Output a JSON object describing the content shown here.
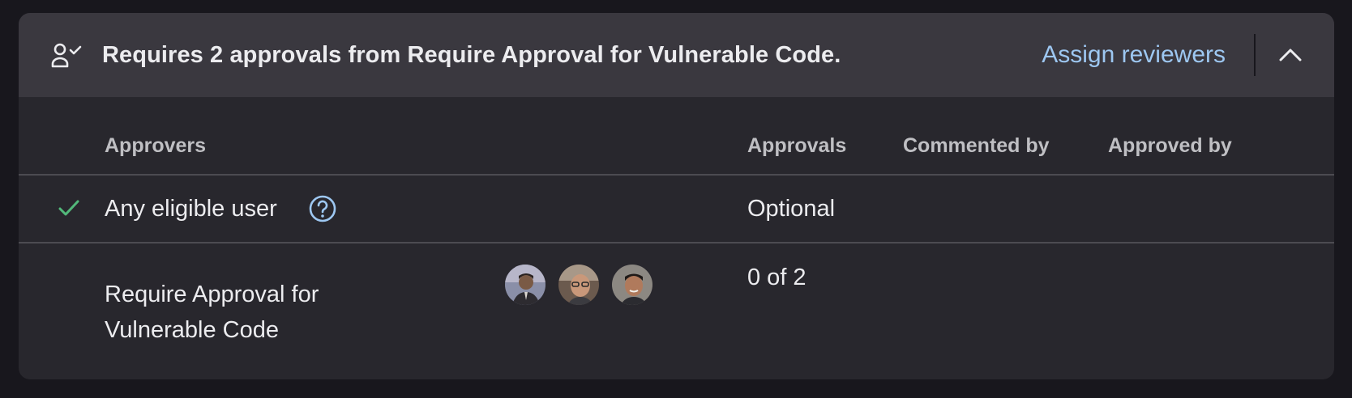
{
  "header": {
    "title": "Requires 2 approvals from Require Approval for Vulnerable Code.",
    "assign_label": "Assign reviewers",
    "approval_icon": "user-check-icon",
    "collapse_icon": "chevron-up-icon"
  },
  "table": {
    "columns": [
      "Approvers",
      "Approvals",
      "Commented by",
      "Approved by"
    ],
    "rows": [
      {
        "status_icon": "check-icon",
        "approver": "Any eligible user",
        "help_icon": "question-circle-icon",
        "approvals": "Optional"
      },
      {
        "approver": "Require Approval for Vulnerable Code",
        "approvals": "0 of 2",
        "approver_avatars": 3
      }
    ]
  },
  "colors": {
    "background": "#18171d",
    "panel": "#28272d",
    "header": "#3a383f",
    "link": "#9dc7f1",
    "success": "#52b87a"
  }
}
